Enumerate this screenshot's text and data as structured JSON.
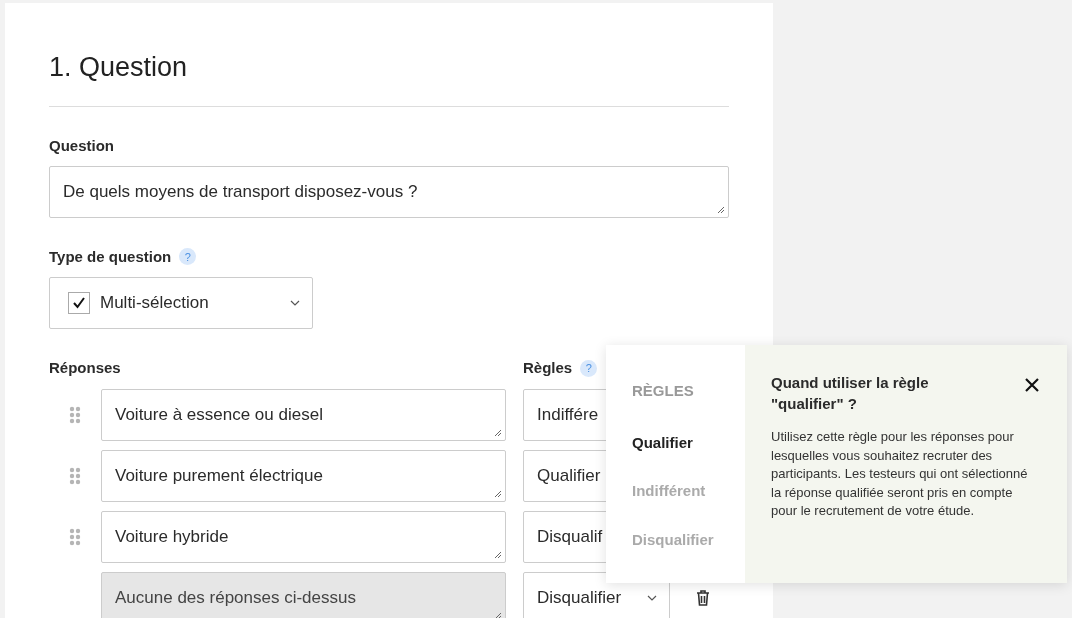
{
  "title": "1. Question",
  "question": {
    "label": "Question",
    "value": "De quels moyens de transport disposez-vous ?"
  },
  "question_type": {
    "label": "Type de question",
    "help": "?",
    "value": "Multi-sélection",
    "checked": true
  },
  "answers_label": "Réponses",
  "rules_label": "Règles",
  "rules_help": "?",
  "answers": [
    {
      "text": "Voiture à essence ou diesel",
      "rule": "Indiffére",
      "draggable": true,
      "disabled": false,
      "chevron": false,
      "deletable": false
    },
    {
      "text": "Voiture purement électrique",
      "rule": "Qualifier",
      "draggable": true,
      "disabled": false,
      "chevron": false,
      "deletable": false
    },
    {
      "text": "Voiture hybride",
      "rule": "Disqualif",
      "draggable": true,
      "disabled": false,
      "chevron": false,
      "deletable": false
    },
    {
      "text": "Aucune des réponses ci-dessus",
      "rule": "Disqualifier",
      "draggable": false,
      "disabled": true,
      "chevron": true,
      "deletable": true
    }
  ],
  "popover": {
    "heading": "RÈGLES",
    "rules": [
      {
        "label": "Qualifier",
        "selected": true
      },
      {
        "label": "Indifférent",
        "selected": false
      },
      {
        "label": "Disqualifier",
        "selected": false
      }
    ],
    "help_title": "Quand utiliser la règle \"qualifier\" ?",
    "help_text": "Utilisez cette règle pour les réponses pour lesquelles vous souhaitez recruter des participants. Les testeurs qui ont sélectionné la réponse qualifiée seront pris en compte pour le recrutement de votre étude."
  }
}
